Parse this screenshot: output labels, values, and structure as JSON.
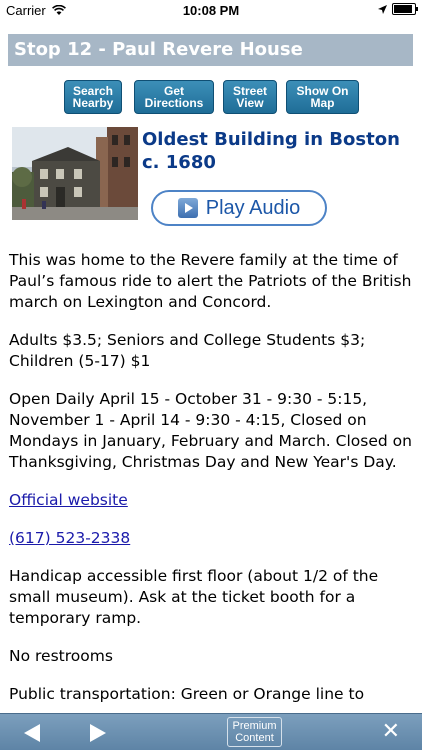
{
  "status_bar": {
    "carrier": "Carrier",
    "time": "10:08 PM"
  },
  "header": {
    "title": "Stop 12 - Paul Revere House"
  },
  "actions": [
    {
      "label": "Search\nNearby"
    },
    {
      "label": "Get\nDirections"
    },
    {
      "label": "Street\nView"
    },
    {
      "label": "Show On\nMap"
    }
  ],
  "feature": {
    "headline": "Oldest Building in Boston c. 1680",
    "audio_label": "Play Audio"
  },
  "content": {
    "intro": "This was home to the Revere family at the time of Paul’s famous ride to alert the Patriots of the British march on Lexington and Concord.",
    "prices": "Adults $3.5; Seniors and College Students $3; Children (5-17) $1",
    "hours": "Open Daily April 15 - October 31 - 9:30 - 5:15, November 1 - April 14 - 9:30 - 4:15, Closed on Mondays in January, February and March. Closed on Thanksgiving, Christmas Day and New Year's Day.",
    "website_link": "Official website",
    "phone_link": "(617) 523-2338",
    "accessibility": "Handicap accessible first floor (about 1/2 of the small museum). Ask at the ticket booth for a temporary ramp.",
    "restrooms": "No restrooms",
    "transport_partial": "Public transportation: Green or Orange line to"
  },
  "toolbar": {
    "premium_label": "Premium\nContent"
  },
  "colors": {
    "title_bar": "#a7b7c6",
    "button": "#2a7aa6",
    "headline": "#0b3a88",
    "link": "#1a1aaa",
    "toolbar": "#6d91b1"
  }
}
